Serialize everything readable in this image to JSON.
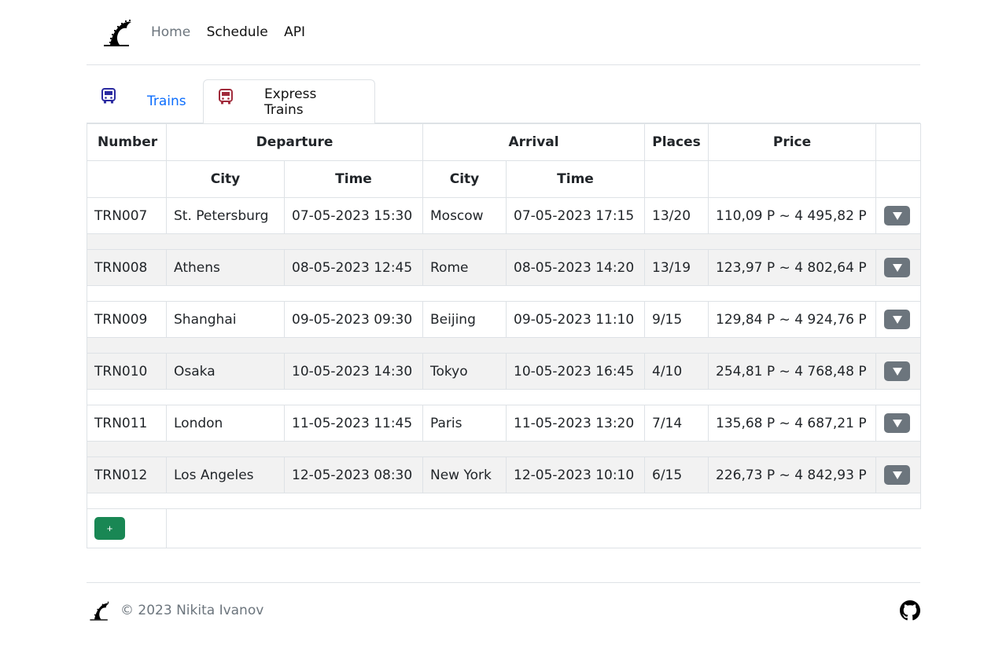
{
  "nav": {
    "links": [
      {
        "label": "Home"
      },
      {
        "label": "Schedule"
      },
      {
        "label": "API"
      }
    ]
  },
  "tabs": [
    {
      "label": "Trains",
      "icon": "train-icon",
      "color": "#2a2aa0"
    },
    {
      "label": "Express Trains",
      "icon": "express-train-icon",
      "color": "#a02a3a"
    }
  ],
  "table": {
    "headers": {
      "number": "Number",
      "departure": "Departure",
      "arrival": "Arrival",
      "places": "Places",
      "price": "Price",
      "dep_city": "City",
      "dep_time": "Time",
      "arr_city": "City",
      "arr_time": "Time"
    },
    "rows": [
      {
        "number": "TRN007",
        "dep_city": "St. Petersburg",
        "dep_time": "07-05-2023 15:30",
        "arr_city": "Moscow",
        "arr_time": "07-05-2023 17:15",
        "places": "13/20",
        "price": "110,09 P ~ 4 495,82 P"
      },
      {
        "number": "TRN008",
        "dep_city": "Athens",
        "dep_time": "08-05-2023 12:45",
        "arr_city": "Rome",
        "arr_time": "08-05-2023 14:20",
        "places": "13/19",
        "price": "123,97 P ~ 4 802,64 P"
      },
      {
        "number": "TRN009",
        "dep_city": "Shanghai",
        "dep_time": "09-05-2023 09:30",
        "arr_city": "Beijing",
        "arr_time": "09-05-2023 11:10",
        "places": "9/15",
        "price": "129,84 P ~ 4 924,76 P"
      },
      {
        "number": "TRN010",
        "dep_city": "Osaka",
        "dep_time": "10-05-2023 14:30",
        "arr_city": "Tokyo",
        "arr_time": "10-05-2023 16:45",
        "places": "4/10",
        "price": "254,81 P ~ 4 768,48 P"
      },
      {
        "number": "TRN011",
        "dep_city": "London",
        "dep_time": "11-05-2023 11:45",
        "arr_city": "Paris",
        "arr_time": "11-05-2023 13:20",
        "places": "7/14",
        "price": "135,68 P ~ 4 687,21 P"
      },
      {
        "number": "TRN012",
        "dep_city": "Los Angeles",
        "dep_time": "12-05-2023 08:30",
        "arr_city": "New York",
        "arr_time": "12-05-2023 10:10",
        "places": "6/15",
        "price": "226,73 P ~ 4 842,93 P"
      }
    ],
    "add_label": "+"
  },
  "footer": {
    "copyright": "© 2023 Nikita Ivanov"
  },
  "colors": {
    "link_muted": "#6c757d",
    "link_active": "#0d6efd",
    "expand_button": "#6c757d",
    "add_button": "#198754",
    "stripe": "#f2f2f2"
  }
}
